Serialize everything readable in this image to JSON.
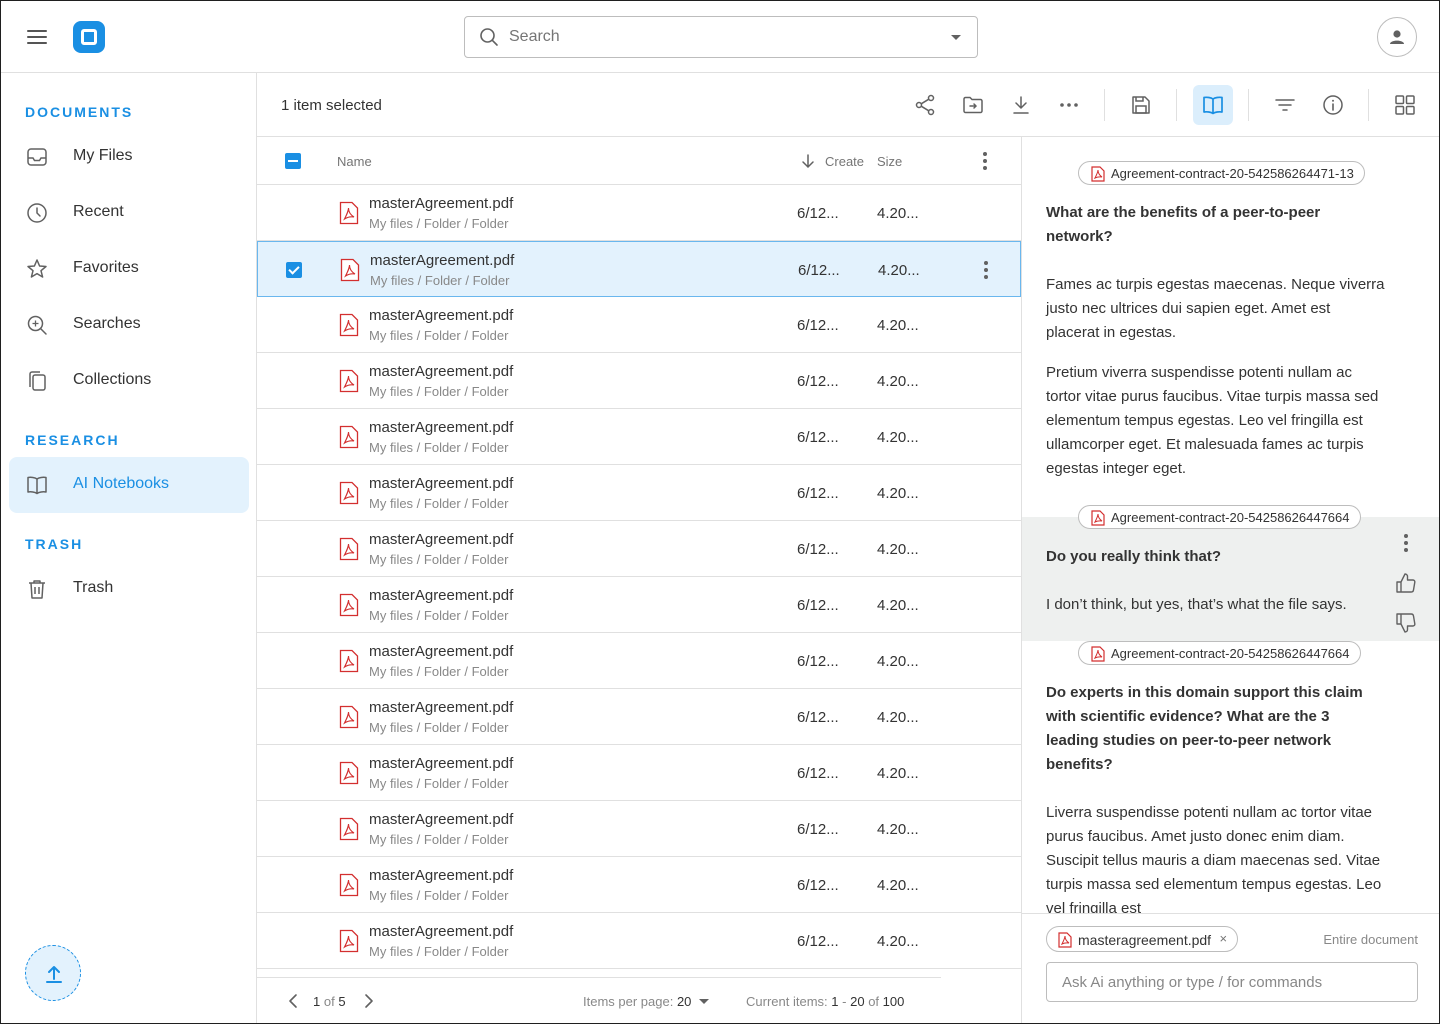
{
  "colors": {
    "accent": "#1a8fe3",
    "accent_light": "#e3f2fd",
    "pdf_red": "#d32f2f",
    "border": "#e0e0e0"
  },
  "header": {
    "search_placeholder": "Search"
  },
  "sidebar": {
    "sections": {
      "documents": "DOCUMENTS",
      "research": "RESEARCH",
      "trash": "TRASH"
    },
    "items": [
      {
        "label": "My Files",
        "icon": "inbox-icon"
      },
      {
        "label": "Recent",
        "icon": "clock-icon"
      },
      {
        "label": "Favorites",
        "icon": "star-icon"
      },
      {
        "label": "Searches",
        "icon": "search-zoom-icon"
      },
      {
        "label": "Collections",
        "icon": "collections-icon"
      },
      {
        "label": "AI Notebooks",
        "icon": "book-icon",
        "active": true
      },
      {
        "label": "Trash",
        "icon": "trash-icon"
      }
    ]
  },
  "toolbar": {
    "selection_text": "1 item selected"
  },
  "table": {
    "columns": {
      "name": "Name",
      "created": "Create",
      "size": "Size"
    },
    "rows": [
      {
        "name": "masterAgreement.pdf",
        "path": "My files / Folder / Folder",
        "date": "6/12...",
        "size": "4.20...",
        "selected": false
      },
      {
        "name": "masterAgreement.pdf",
        "path": "My files / Folder / Folder",
        "date": "6/12...",
        "size": "4.20...",
        "selected": true
      },
      {
        "name": "masterAgreement.pdf",
        "path": "My files / Folder / Folder",
        "date": "6/12...",
        "size": "4.20...",
        "selected": false
      },
      {
        "name": "masterAgreement.pdf",
        "path": "My files / Folder / Folder",
        "date": "6/12...",
        "size": "4.20...",
        "selected": false
      },
      {
        "name": "masterAgreement.pdf",
        "path": "My files / Folder / Folder",
        "date": "6/12...",
        "size": "4.20...",
        "selected": false
      },
      {
        "name": "masterAgreement.pdf",
        "path": "My files / Folder / Folder",
        "date": "6/12...",
        "size": "4.20...",
        "selected": false
      },
      {
        "name": "masterAgreement.pdf",
        "path": "My files / Folder / Folder",
        "date": "6/12...",
        "size": "4.20...",
        "selected": false
      },
      {
        "name": "masterAgreement.pdf",
        "path": "My files / Folder / Folder",
        "date": "6/12...",
        "size": "4.20...",
        "selected": false
      },
      {
        "name": "masterAgreement.pdf",
        "path": "My files / Folder / Folder",
        "date": "6/12...",
        "size": "4.20...",
        "selected": false
      },
      {
        "name": "masterAgreement.pdf",
        "path": "My files / Folder / Folder",
        "date": "6/12...",
        "size": "4.20...",
        "selected": false
      },
      {
        "name": "masterAgreement.pdf",
        "path": "My files / Folder / Folder",
        "date": "6/12...",
        "size": "4.20...",
        "selected": false
      },
      {
        "name": "masterAgreement.pdf",
        "path": "My files / Folder / Folder",
        "date": "6/12...",
        "size": "4.20...",
        "selected": false
      },
      {
        "name": "masterAgreement.pdf",
        "path": "My files / Folder / Folder",
        "date": "6/12...",
        "size": "4.20...",
        "selected": false
      },
      {
        "name": "masterAgreement.pdf",
        "path": "My files / Folder / Folder",
        "date": "6/12...",
        "size": "4.20...",
        "selected": false
      }
    ]
  },
  "pagination": {
    "page": "1",
    "of_label": "of",
    "total_pages": "5",
    "items_per_page_label": "Items per page:",
    "items_per_page": "20",
    "current_items_label": "Current items:",
    "range_start": "1",
    "range_sep": "-",
    "range_end": "20",
    "total_items": "100"
  },
  "ai_panel": {
    "messages": [
      {
        "source": "Agreement-contract-20-542586264471-13",
        "question": "What are the benefits of a peer-to-peer network?",
        "answer_p1": "Fames ac turpis egestas maecenas. Neque viverra justo nec ultrices dui sapien eget. Amet est placerat in egestas.",
        "answer_p2": "Pretium viverra suspendisse potenti nullam ac tortor vitae purus faucibus. Vitae turpis massa sed elementum tempus egestas. Leo vel fringilla est ullamcorper eget. Et malesuada fames ac turpis egestas integer eget."
      },
      {
        "source": "Agreement-contract-20-54258626447664",
        "question": "Do you really think that?",
        "answer_p1": "I don’t think, but yes, that’s what the file says."
      },
      {
        "source": "Agreement-contract-20-54258626447664",
        "question": "Do experts in this domain support this claim with scientific evidence? What are the 3 leading studies on peer-to-peer network benefits?",
        "answer_p1": "Liverra suspendisse potenti nullam ac tortor vitae purus faucibus. Amet justo donec enim diam. Suscipit tellus mauris a diam maecenas sed. Vitae turpis massa sed elementum tempus egestas. Leo vel fringilla est"
      }
    ],
    "composer": {
      "context_file": "masteragreement.pdf",
      "close_glyph": "×",
      "scope": "Entire document",
      "placeholder": "Ask Ai anything or type / for commands"
    }
  }
}
